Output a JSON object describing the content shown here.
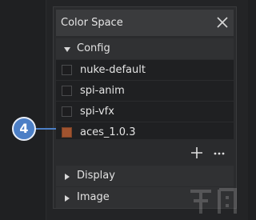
{
  "panel": {
    "title": "Color Space"
  },
  "config": {
    "label": "Config",
    "items": [
      {
        "label": "nuke-default",
        "color": "#1d1d1f"
      },
      {
        "label": "spi-anim",
        "color": "#1d1d1f"
      },
      {
        "label": "spi-vfx",
        "color": "#1d1d1f"
      },
      {
        "label": "aces_1.0.3",
        "color": "#a0532f"
      }
    ]
  },
  "sections": {
    "display": "Display",
    "image": "Image"
  },
  "callout": {
    "number": "4",
    "color": "#4c7fc6"
  },
  "icons": {
    "close": "close-icon",
    "expanded": "caret-down-icon",
    "collapsed": "caret-right-icon",
    "add": "plus-icon",
    "more": "more-icon"
  }
}
